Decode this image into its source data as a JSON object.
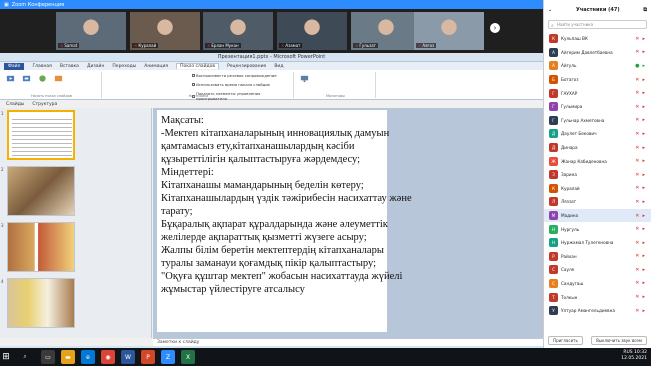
{
  "zoom_window": {
    "title": "Zoom Конференция"
  },
  "video_tiles": [
    {
      "name": "Samat",
      "bg": "#5d6a77"
    },
    {
      "name": "Куралай",
      "bg": "#6b5a4e"
    },
    {
      "name": "Ерлан Мукан",
      "bg": "#4f5b66"
    },
    {
      "name": "Азамат",
      "bg": "#3e4a55"
    },
    {
      "name": "Гульзат",
      "bg": "#6a7a86"
    },
    {
      "name": "Аягоз",
      "bg": "#8a9aa8"
    }
  ],
  "powerpoint": {
    "title": "Презентация1.pptx - Microsoft PowerPoint",
    "tabs": [
      "Файл",
      "Главная",
      "Вставка",
      "Дизайн",
      "Переходы",
      "Анимация",
      "Показ слайдов",
      "Рецензирование",
      "Вид"
    ],
    "active_tab": "Показ слайдов",
    "ribbon_groups": [
      "Начать показ слайдов",
      "Настройка",
      "Мониторы"
    ],
    "checkbox_1": "Воспроизвести речевое сопровождение",
    "checkbox_2": "Использовать время показа слайдов",
    "checkbox_3": "Показать элементы управления проигрывателя",
    "panel_tabs": [
      "Слайды",
      "Структура"
    ],
    "slide_text": [
      "Мақсаты:",
      "-Мектеп кітапханаларының инновациялық дамуын",
      "қамтамасыз ету,кітапханашылардың кәсіби",
      "құзыреттілігін қалыптастыруға жәрдемдесу;",
      "Міндеттері:",
      "Кітапханашы мамандарының беделін көтеру;",
      "Кітапханашылардың үздік тәжірибесін насихаттау және",
      "тарату;",
      "Бұқаралық ақпарат құралдарында және әлеуметтік",
      "желілерде ақпараттық қызметті жүзеге асыру;",
      "Жалпы білім беретін  мектептердің кітапханалары",
      "туралы заманауи қоғамдық пікір қалыптастыру;",
      "\"Оқуға құштар мектеп\" жобасын насихаттауда жүйелі",
      "жұмыстар үйлестіруге атсалысу"
    ],
    "slide_numbers": [
      "1",
      "2",
      "3",
      "4"
    ],
    "notes_placeholder": "Заметки к слайду"
  },
  "participants": {
    "header": "Участники (47)",
    "search_placeholder": "Найти участника",
    "list": [
      {
        "name": "Кульпаш ВК",
        "initials": "К",
        "color": "#c0392b",
        "mic": "off",
        "video": "off"
      },
      {
        "name": "Айгерим Давлетбаевна",
        "initials": "А",
        "color": "#2c3e50",
        "mic": "off",
        "video": "off"
      },
      {
        "name": "Айгуль",
        "initials": "А",
        "color": "#e67e22",
        "mic": "on",
        "video": "on"
      },
      {
        "name": "Ботагоз",
        "initials": "Б",
        "color": "#d35400",
        "mic": "off",
        "video": "off"
      },
      {
        "name": "ГАУХАР",
        "initials": "Г",
        "color": "#c0392b",
        "mic": "off",
        "video": "off"
      },
      {
        "name": "Гульмира",
        "initials": "Г",
        "color": "#8e44ad",
        "mic": "off",
        "video": "off"
      },
      {
        "name": "Гульнар Ахметовна",
        "initials": "Г",
        "color": "#2c3e50",
        "mic": "off",
        "video": "off"
      },
      {
        "name": "Даулет Бекович",
        "initials": "Д",
        "color": "#16a085",
        "mic": "off",
        "video": "off"
      },
      {
        "name": "Динара",
        "initials": "Д",
        "color": "#c0392b",
        "mic": "off",
        "video": "off"
      },
      {
        "name": "Жанар Кабиденовна",
        "initials": "Ж",
        "color": "#e74c3c",
        "mic": "off",
        "video": "off"
      },
      {
        "name": "Зарина",
        "initials": "З",
        "color": "#c0392b",
        "mic": "off",
        "video": "off"
      },
      {
        "name": "Куралай",
        "initials": "К",
        "color": "#d35400",
        "mic": "off",
        "video": "off"
      },
      {
        "name": "Ляззат",
        "initials": "Л",
        "color": "#c0392b",
        "mic": "off",
        "video": "off"
      },
      {
        "name": "Мадина",
        "initials": "М",
        "color": "#8e44ad",
        "mic": "off",
        "video": "off"
      },
      {
        "name": "Нургуль",
        "initials": "Н",
        "color": "#27ae60",
        "mic": "off",
        "video": "off"
      },
      {
        "name": "Нуржамал Тулегеновна",
        "initials": "Н",
        "color": "#16a085",
        "mic": "off",
        "video": "off"
      },
      {
        "name": "Райхан",
        "initials": "Р",
        "color": "#c0392b",
        "mic": "off",
        "video": "off"
      },
      {
        "name": "Сауле",
        "initials": "С",
        "color": "#c0392b",
        "mic": "off",
        "video": "off"
      },
      {
        "name": "Сандугаш",
        "initials": "С",
        "color": "#e67e22",
        "mic": "off",
        "video": "off"
      },
      {
        "name": "Толкын",
        "initials": "Т",
        "color": "#c0392b",
        "mic": "off",
        "video": "off"
      },
      {
        "name": "Ултуар Амангельдиевна",
        "initials": "У",
        "color": "#2c3e50",
        "mic": "off",
        "video": "off"
      }
    ],
    "highlight_index": 13,
    "invite_button": "Пригласить",
    "mute_all_button": "Выключить звук всем"
  },
  "taskbar": {
    "time": "10:32",
    "date": "12.05.2021",
    "lang": "RUS"
  }
}
